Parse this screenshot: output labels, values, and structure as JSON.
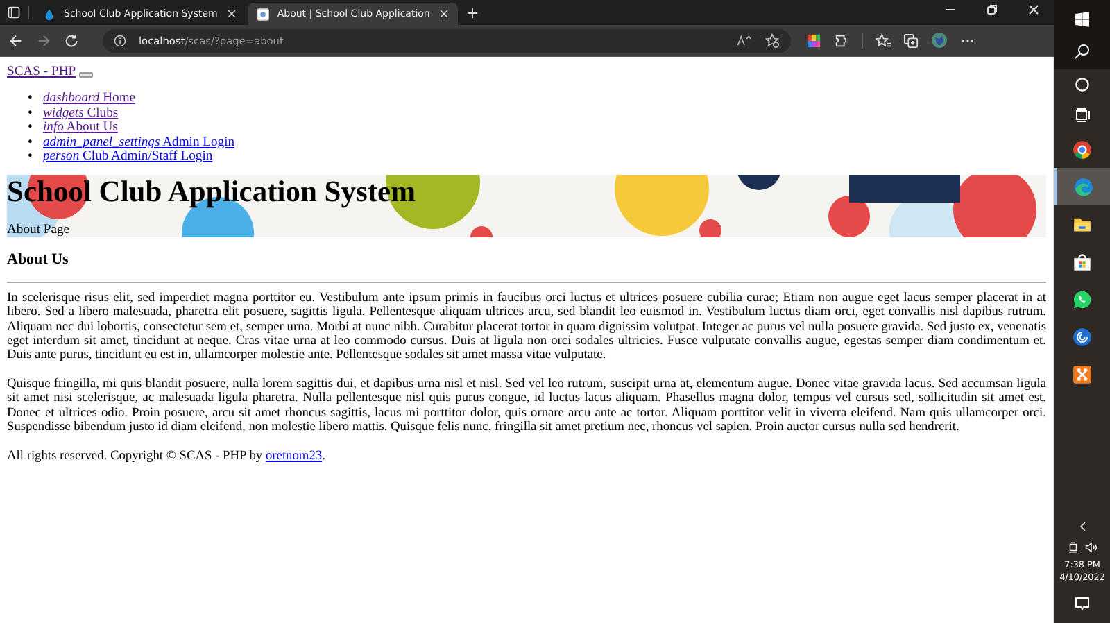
{
  "browser": {
    "tabs": [
      {
        "title": "School Club Application System",
        "selected": false
      },
      {
        "title": "About | School Club Application",
        "selected": true
      }
    ],
    "address": {
      "host": "localhost",
      "path": "/scas/?page=about"
    }
  },
  "page": {
    "brand": "SCAS - PHP",
    "nav": [
      {
        "bullet": "•",
        "icon": "dashboard",
        "label": "Home",
        "visited": true
      },
      {
        "bullet": "•",
        "icon": "widgets",
        "label": "Clubs",
        "visited": true
      },
      {
        "bullet": "•",
        "icon": "info",
        "label": "About Us",
        "visited": true
      },
      {
        "bullet": "•",
        "icon": "admin_panel_settings",
        "label": "Admin Login",
        "visited": false
      },
      {
        "bullet": "•",
        "icon": "person",
        "label": "Club Admin/Staff Login",
        "visited": false
      }
    ],
    "banner": {
      "title": "School Club Application System",
      "subtitle": "About Page"
    },
    "heading": "About Us",
    "paragraphs": [
      "In scelerisque risus elit, sed imperdiet magna porttitor eu. Vestibulum ante ipsum primis in faucibus orci luctus et ultrices posuere cubilia curae; Etiam non augue eget lacus semper placerat in at libero. Sed a libero malesuada, pharetra elit posuere, sagittis ligula. Pellentesque aliquam ultrices arcu, sed blandit leo euismod in. Vestibulum luctus diam orci, eget convallis nisl dapibus rutrum. Aliquam nec dui lobortis, consectetur sem et, semper urna. Morbi at nunc nibh. Curabitur placerat tortor in quam dignissim volutpat. Integer ac purus vel nulla posuere gravida. Sed justo ex, venenatis eget interdum sit amet, tincidunt at neque. Cras vitae urna at leo commodo cursus. Duis at ligula non orci sodales ultricies. Fusce vulputate convallis augue, egestas semper diam condimentum et. Duis ante purus, tincidunt eu est in, ullamcorper molestie ante. Pellentesque sodales sit amet massa vitae vulputate.",
      "Quisque fringilla, mi quis blandit posuere, nulla lorem sagittis dui, et dapibus urna nisl et nisl. Sed vel leo rutrum, suscipit urna at, elementum augue. Donec vitae gravida lacus. Sed accumsan ligula sit amet nisi scelerisque, ac malesuada ligula pharetra. Nulla pellentesque nisl quis purus congue, id luctus lacus aliquam. Phasellus magna dolor, tempus vel cursus sed, sollicitudin sit amet est. Donec et ultrices odio. Proin posuere, arcu sit amet rhoncus sagittis, lacus mi porttitor dolor, quis ornare arcu ante ac tortor. Aliquam porttitor velit in viverra eleifend. Nam quis ullamcorper orci. Suspendisse bibendum justo id diam eleifend, non molestie libero mattis. Quisque felis nunc, fringilla sit amet pretium nec, rhoncus vel sapien. Proin auctor cursus nulla sed hendrerit."
    ],
    "footer": {
      "text": "All rights reserved. Copyright © SCAS - PHP by ",
      "author": "oretnom23",
      "end": "."
    }
  },
  "taskbar": {
    "apps": [
      {
        "kind": "chrome",
        "selected": false
      },
      {
        "kind": "edge",
        "selected": true
      },
      {
        "kind": "folder",
        "selected": false
      },
      {
        "kind": "store",
        "selected": false
      },
      {
        "kind": "whatsapp",
        "selected": false
      },
      {
        "kind": "swirl",
        "selected": false
      },
      {
        "kind": "xampp",
        "selected": false
      }
    ],
    "time": "7:38 PM",
    "date": "4/10/2022"
  }
}
